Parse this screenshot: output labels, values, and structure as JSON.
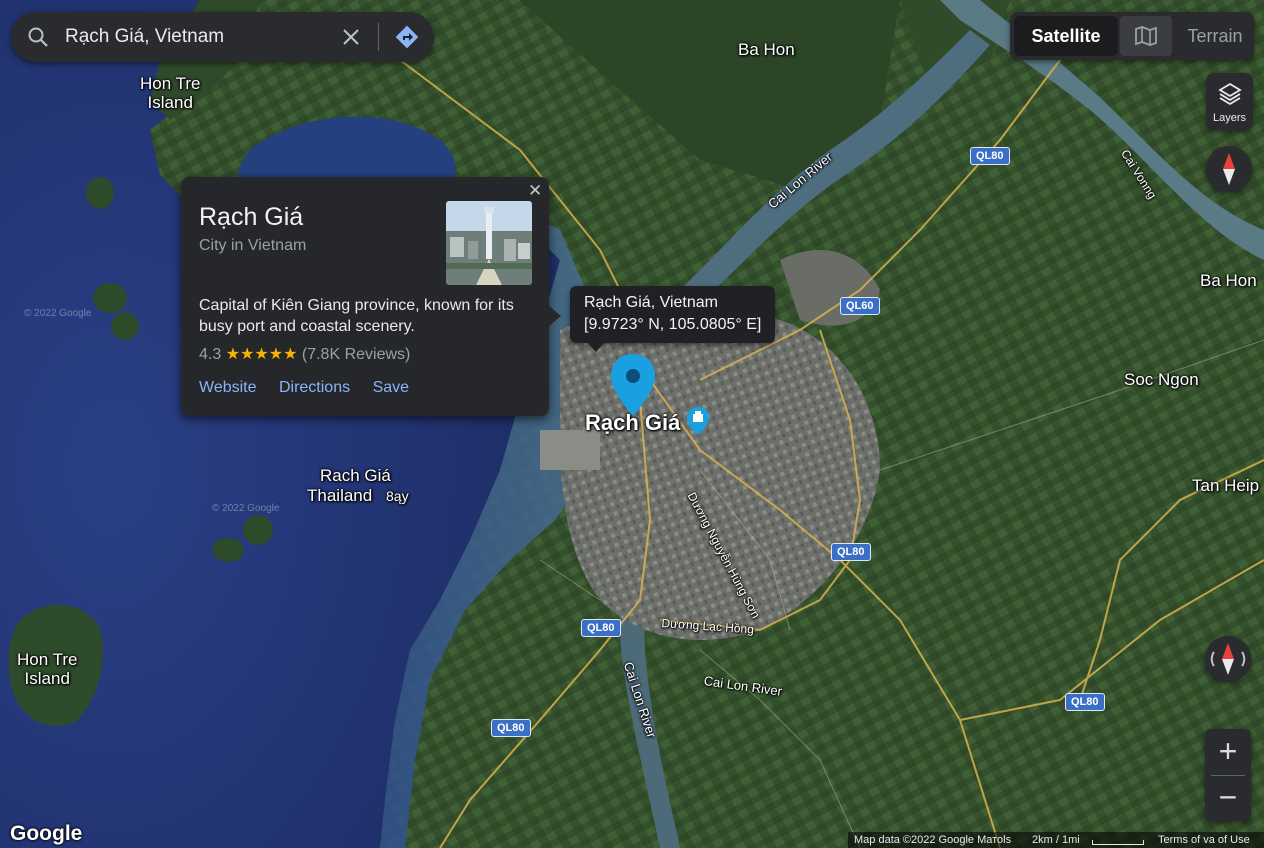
{
  "search": {
    "value": "Rạch Giá, Vietnam"
  },
  "map_type": {
    "satellite": "Satellite",
    "terrain": "Terrain",
    "selected": "Satellite"
  },
  "layers": {
    "label": "Layers"
  },
  "place_card": {
    "title": "Rạch Giá",
    "subtitle": "City in Vietnam",
    "description": "Capital of Kiên Giang province, known for its busy port and coastal scenery.",
    "rating": "4.3",
    "stars": "★★★★★",
    "reviews": "(7.8K Reviews)",
    "actions": [
      "Website",
      "Directions",
      "Save"
    ]
  },
  "tooltip": {
    "name": "Rạch Giá, Vietnam",
    "coords": "[9.9723° N, 105.0805° E]"
  },
  "map_labels": {
    "ba_hon_top": "Ba Hon",
    "hon_tre_top": "Hon Tre\nIsland",
    "ba_hon_right": "Ba Hon",
    "soc_ngon": "Soc Ngon",
    "tan_heip": "Tan Heip",
    "city": "Rạch Giá",
    "rach_gia_thailand_1": "Rach Giá",
    "rach_gia_thailand_2": "Thailand",
    "rach_gia_thailand_3": "8ąy",
    "hon_tre_bottom": "Hon Tre\nIsland",
    "cai_lon_river_top": "Cai Lon River",
    "cai_lon_river_bottom": "Cai Lon River",
    "cai_lon_river_south": "Cai Lon River",
    "cai_river_ne": "Cai Vonng",
    "duong_nguyen": "Dương Nguyễn Hùng Sơn",
    "duong_lac_hong": "Dương Lạc Hồng",
    "watermark": "© 2022 Google"
  },
  "road_shields": [
    "QL80",
    "QL60",
    "QL80",
    "QL80",
    "QL80",
    "QL80"
  ],
  "footer": {
    "map_data": "Map data ©2022 Google Mатоls",
    "scale": "2km / 1mi",
    "terms": "Terms of va of Use"
  },
  "google_logo": "Google",
  "zoom": {
    "in": "+",
    "out": "−"
  },
  "colors": {
    "accent": "#8ab4f8",
    "pin": "#1a9fe0",
    "panel": "#26272a",
    "shield": "#3b6fc6"
  }
}
